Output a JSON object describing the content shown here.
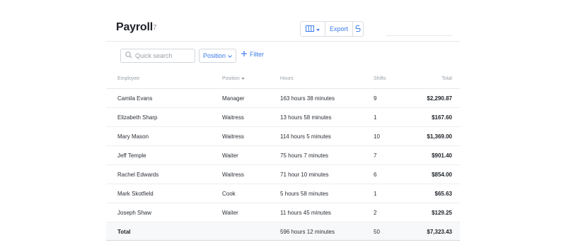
{
  "header": {
    "title": "Payroll",
    "count": "7",
    "toolbar": {
      "columns_icon": "columns-icon",
      "export_label": "Export",
      "toggle_icon": "toggle-icon"
    }
  },
  "filters": {
    "search_placeholder": "Quick search",
    "position_label": "Position",
    "filter_label": "Filter"
  },
  "table": {
    "columns": {
      "employee": "Employee",
      "position": "Position",
      "hours": "Hours",
      "shifts": "Shifts",
      "total": "Total"
    },
    "rows": [
      {
        "employee": "Camila Evans",
        "position": "Manager",
        "hours": "163 hours 38 minutes",
        "shifts": "9",
        "total": "$2,290.87"
      },
      {
        "employee": "Elizabeth Sharp",
        "position": "Waitress",
        "hours": "13 hours 58 minutes",
        "shifts": "1",
        "total": "$167.60"
      },
      {
        "employee": "Mary Mason",
        "position": "Waitress",
        "hours": "114 hours 5 minutes",
        "shifts": "10",
        "total": "$1,369.00"
      },
      {
        "employee": "Jeff Temple",
        "position": "Waiter",
        "hours": "75 hours 7 minutes",
        "shifts": "7",
        "total": "$901.40"
      },
      {
        "employee": "Rachel Edwards",
        "position": "Waitress",
        "hours": "71 hour 10 minutes",
        "shifts": "6",
        "total": "$854.00"
      },
      {
        "employee": "Mark Skotfield",
        "position": "Cook",
        "hours": "5 hours 58 minutes",
        "shifts": "1",
        "total": "$65.63"
      },
      {
        "employee": "Joseph Shaw",
        "position": "Waiter",
        "hours": "11 hours 45 minutes",
        "shifts": "2",
        "total": "$129.25"
      }
    ],
    "total": {
      "label": "Total",
      "hours": "596 hours 12 minutes",
      "shifts": "50",
      "total": "$7,323.43"
    }
  },
  "colors": {
    "accent": "#3b7be8",
    "border": "#e6e8eb",
    "muted": "#9aa0a8"
  }
}
